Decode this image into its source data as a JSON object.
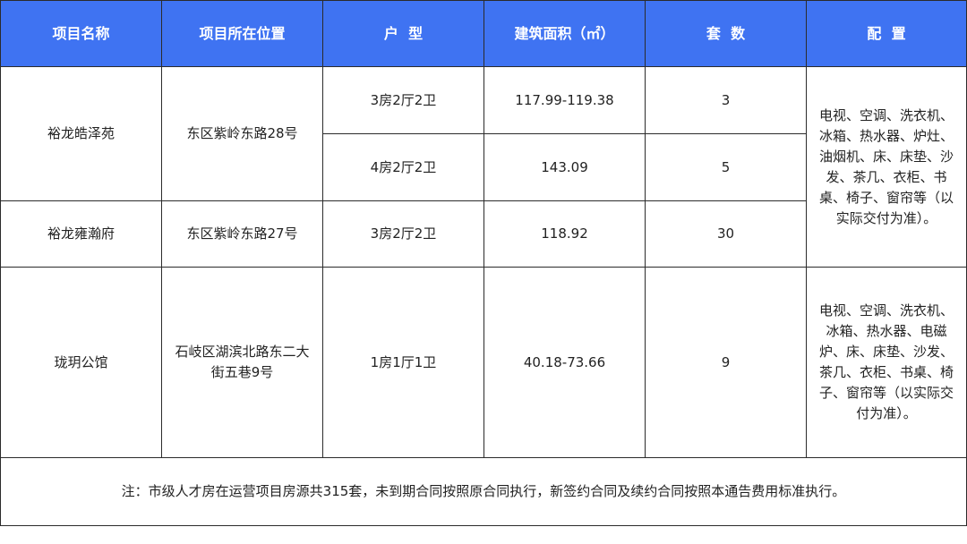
{
  "headers": {
    "name": "项目名称",
    "location": "项目所在位置",
    "type": "户  型",
    "area": "建筑面积（㎡）",
    "count": "套  数",
    "config": "配  置"
  },
  "projects": [
    {
      "name": "裕龙皓泽苑",
      "location": "东区紫岭东路28号",
      "units": [
        {
          "type": "3房2厅2卫",
          "area": "117.99-119.38",
          "count": "3"
        },
        {
          "type": "4房2厅2卫",
          "area": "143.09",
          "count": "5"
        }
      ]
    },
    {
      "name": "裕龙雍瀚府",
      "location": "东区紫岭东路27号",
      "units": [
        {
          "type": "3房2厅2卫",
          "area": "118.92",
          "count": "30"
        }
      ]
    },
    {
      "name": "珑玥公馆",
      "location": "石岐区湖滨北路东二大街五巷9号",
      "units": [
        {
          "type": "1房1厅1卫",
          "area": "40.18-73.66",
          "count": "9"
        }
      ]
    }
  ],
  "configs": {
    "group1": "电视、空调、洗衣机、冰箱、热水器、炉灶、油烟机、床、床垫、沙发、茶几、衣柜、书桌、椅子、窗帘等（以实际交付为准）。",
    "group2": "电视、空调、洗衣机、冰箱、热水器、电磁炉、床、床垫、沙发、茶几、衣柜、书桌、椅子、窗帘等（以实际交付为准）。"
  },
  "note": "注：市级人才房在运营项目房源共315套，未到期合同按照原合同执行，新签约合同及续约合同按照本通告费用标准执行。"
}
